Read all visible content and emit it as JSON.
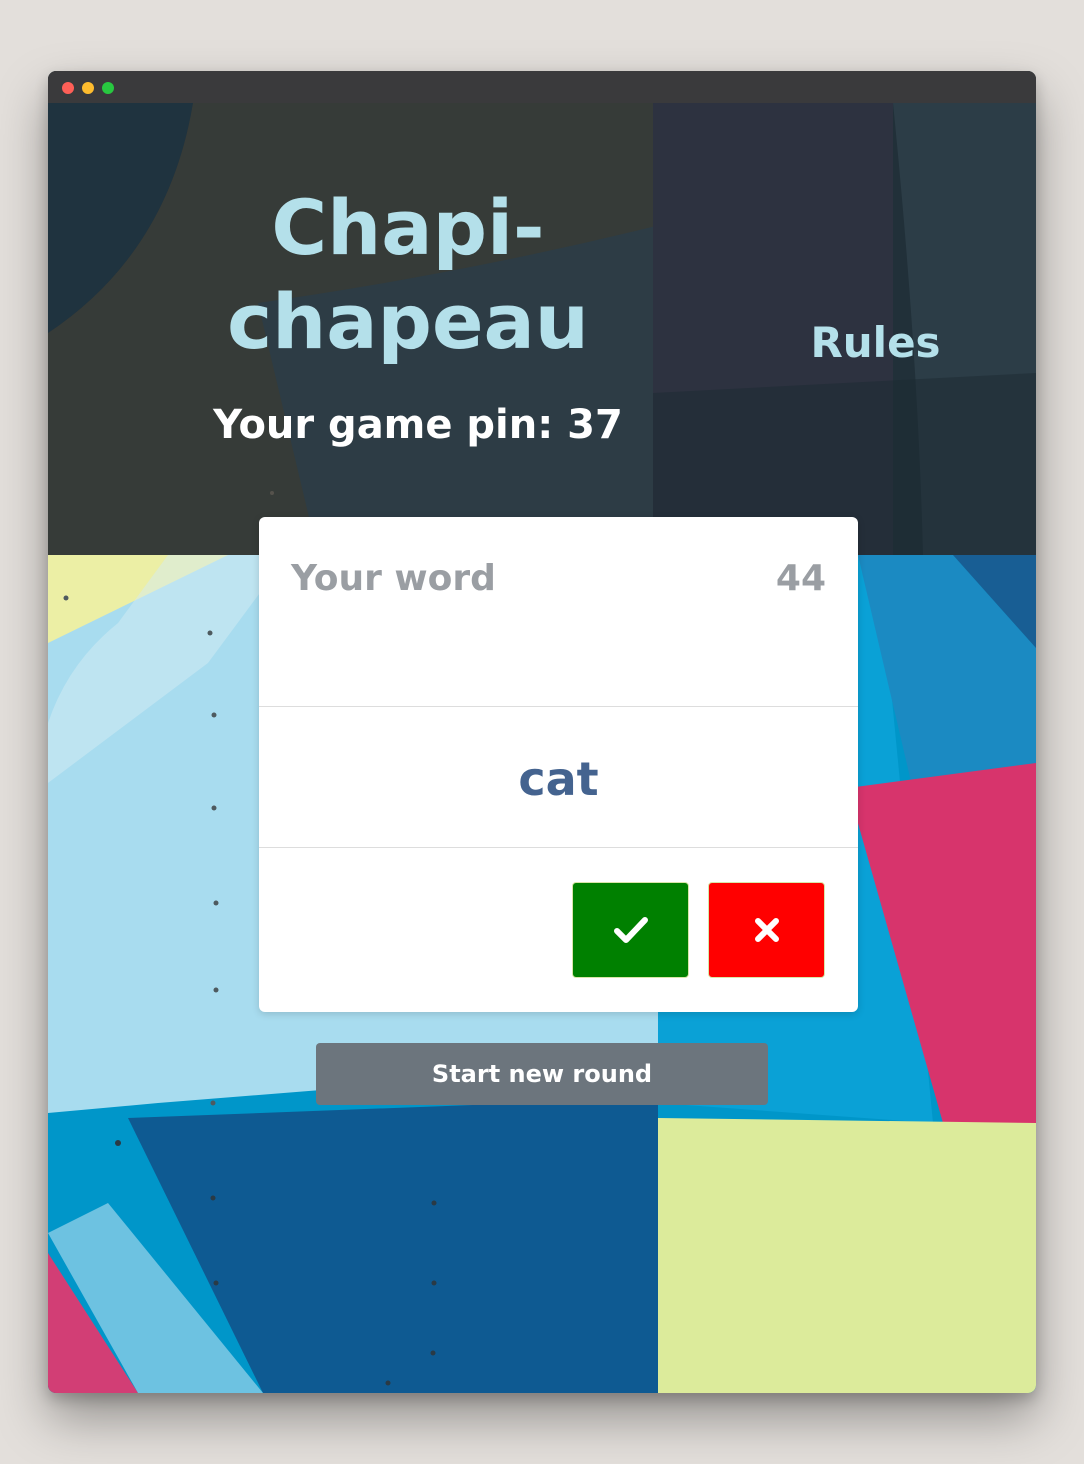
{
  "app": {
    "title_line1": "Chapi-",
    "title_line2": "chapeau",
    "pin_text": "Your game pin: 37"
  },
  "nav": {
    "rules_label": "Rules"
  },
  "card": {
    "label": "Your word",
    "timer": "44",
    "word": "cat"
  },
  "actions": {
    "start_new_round_label": "Start new round"
  },
  "colors": {
    "title": "#b4e0ea",
    "word": "#44638f",
    "correct": "#008000",
    "wrong": "#ff0000",
    "secondary_button": "#6c757d"
  },
  "icons": {
    "correct": "check-icon",
    "wrong": "x-icon"
  }
}
